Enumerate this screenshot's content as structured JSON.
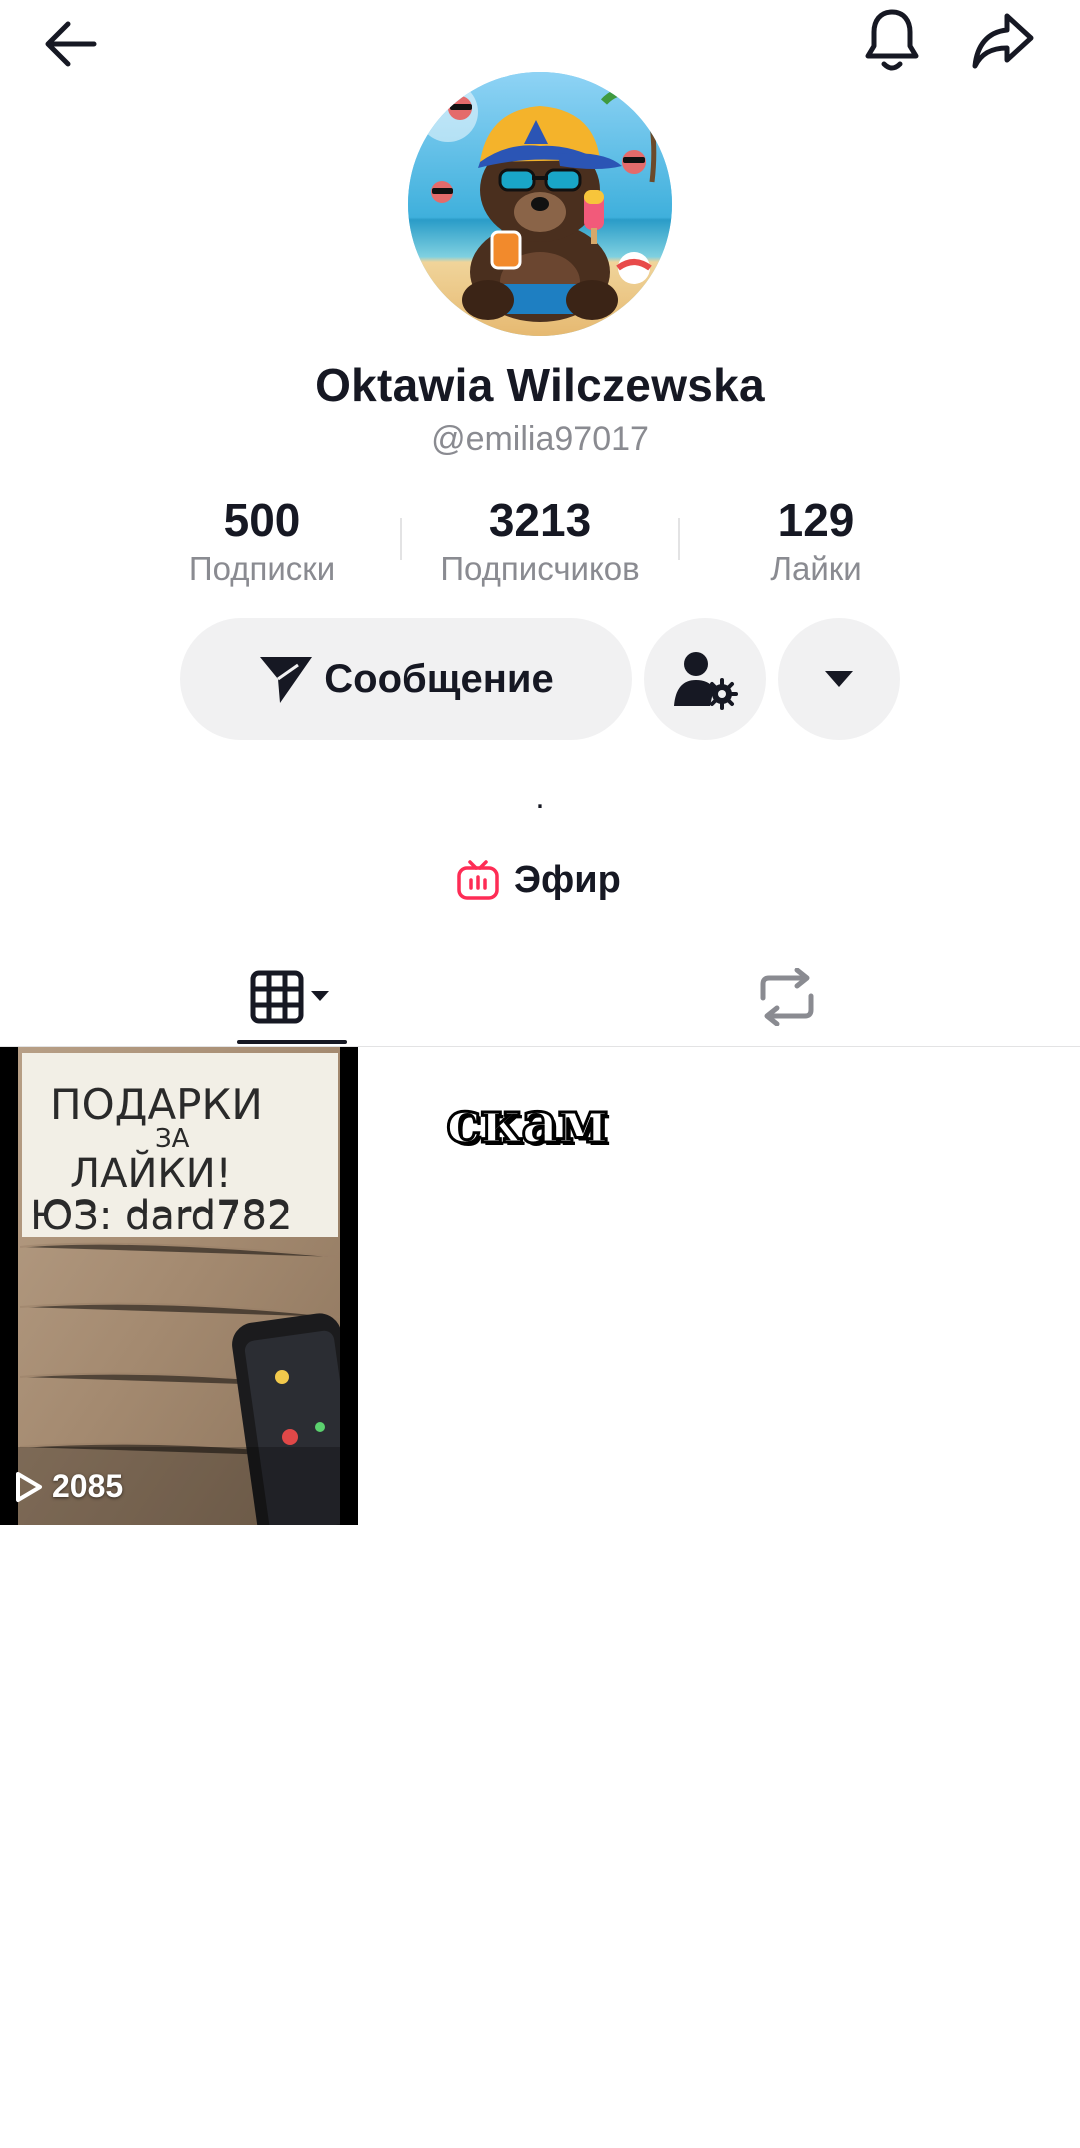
{
  "profile": {
    "display_name": "Oktawia Wilczewska",
    "username": "@emilia97017",
    "bio": "."
  },
  "stats": {
    "following": {
      "value": "500",
      "label": "Подписки"
    },
    "followers": {
      "value": "3213",
      "label": "Подписчиков"
    },
    "likes": {
      "value": "129",
      "label": "Лайки"
    }
  },
  "actions": {
    "message_label": "Сообщение"
  },
  "live": {
    "label": "Эфир"
  },
  "videos": [
    {
      "views": "2085",
      "note_lines": [
        "ПОДАРКИ",
        "ЗА",
        "ЛАЙКИ!",
        "ЮЗ: dard782"
      ]
    }
  ],
  "sticker": {
    "text": "скам"
  },
  "icons": {
    "back": "arrow-left-icon",
    "bell": "bell-icon",
    "share": "share-arrow-icon",
    "message": "paper-plane-icon",
    "friend_settings": "user-gear-icon",
    "more": "caret-down-icon",
    "live": "tv-icon",
    "videos_tab": "grid-icon",
    "reposts_tab": "repost-icon",
    "play": "play-icon"
  },
  "colors": {
    "live_accent": "#fe2c55",
    "text_primary": "#161823",
    "text_secondary": "#8a8b91",
    "button_bg": "#f1f1f2"
  }
}
